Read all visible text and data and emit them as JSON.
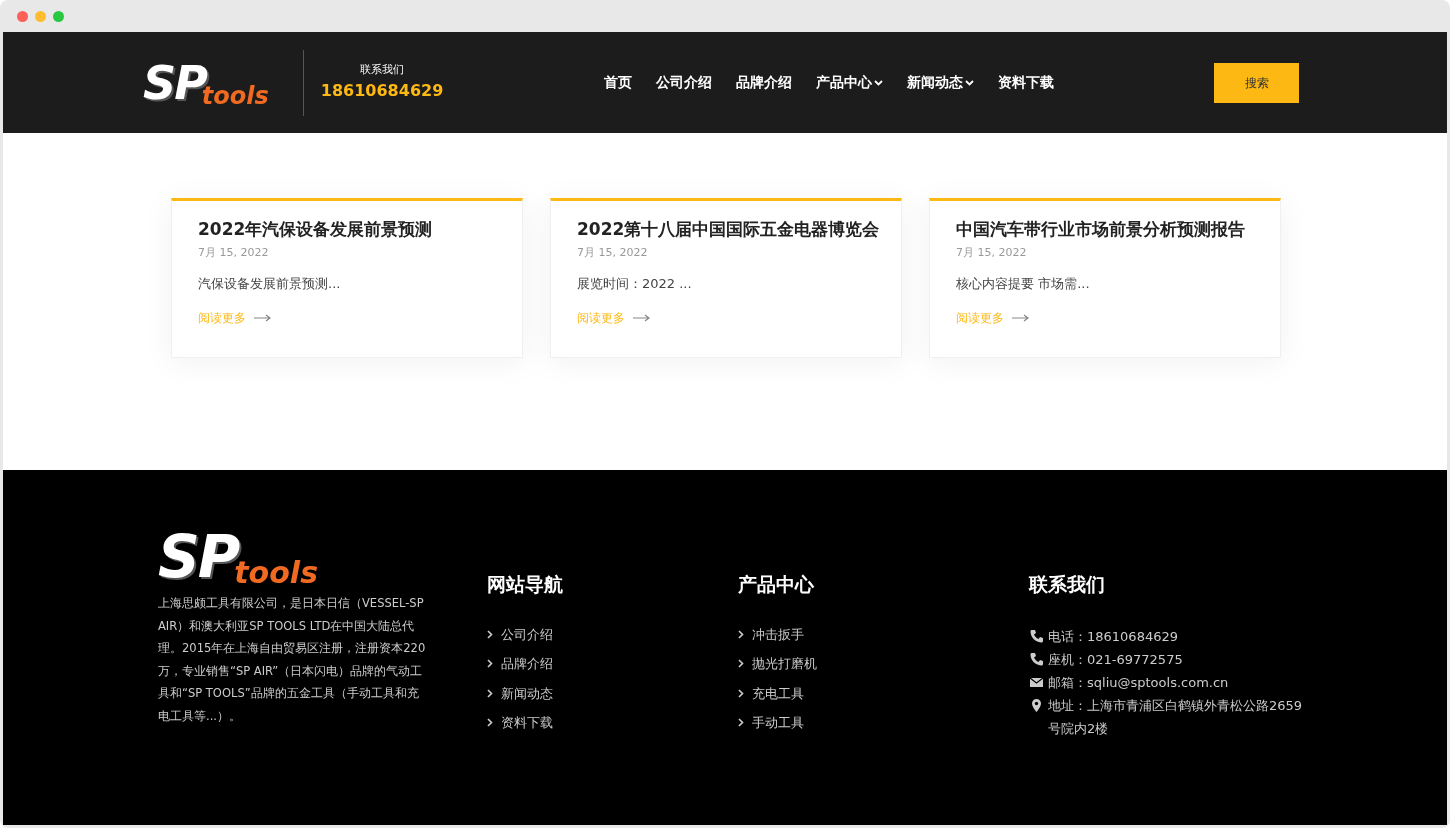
{
  "logo": {
    "mark": "SP",
    "word": "tools"
  },
  "header": {
    "contact_label": "联系我们",
    "phone": "18610684629",
    "search_button": "搜索"
  },
  "nav": [
    {
      "label": "首页",
      "has_dropdown": false
    },
    {
      "label": "公司介绍",
      "has_dropdown": false
    },
    {
      "label": "品牌介绍",
      "has_dropdown": false
    },
    {
      "label": "产品中心",
      "has_dropdown": true
    },
    {
      "label": "新闻动态",
      "has_dropdown": true
    },
    {
      "label": "资料下载",
      "has_dropdown": false
    }
  ],
  "posts": [
    {
      "title": "2022年汽保设备发展前景预测",
      "date": "7月 15, 2022",
      "excerpt": "汽保设备发展前景预测...",
      "read_more": "阅读更多"
    },
    {
      "title": "2022第十八届中国国际五金电器博览会",
      "date": "7月 15, 2022",
      "excerpt": "展览时间：2022 ...",
      "read_more": "阅读更多"
    },
    {
      "title": "中国汽车带行业市场前景分析预测报告",
      "date": "7月 15, 2022",
      "excerpt": "核心内容提要 市场需...",
      "read_more": "阅读更多"
    }
  ],
  "footer": {
    "logo": {
      "mark": "SP",
      "word": "tools"
    },
    "about": "上海思颇工具有限公司，是日本日信（VESSEL-SP AIR）和澳大利亚SP TOOLS LTD在中国大陆总代理。2015年在上海自由贸易区注册，注册资本220万，专业销售“SP AIR”（日本闪电）品牌的气动工具和“SP TOOLS”品牌的五金工具（手动工具和充电工具等...）。",
    "site_nav": {
      "title": "网站导航",
      "links": [
        "公司介绍",
        "品牌介绍",
        "新闻动态",
        "资料下载"
      ]
    },
    "products": {
      "title": "产品中心",
      "links": [
        "冲击扳手",
        "抛光打磨机",
        "充电工具",
        "手动工具"
      ]
    },
    "contact": {
      "title": "联系我们",
      "items": [
        {
          "kind": "phone",
          "text": "电话：18610684629"
        },
        {
          "kind": "phone",
          "text": "座机：021-69772575"
        },
        {
          "kind": "mail",
          "text": "邮箱：sqliu@sptools.com.cn"
        },
        {
          "kind": "pin",
          "text": "地址：上海市青浦区白鹤镇外青松公路2659号院内2楼"
        }
      ]
    }
  }
}
